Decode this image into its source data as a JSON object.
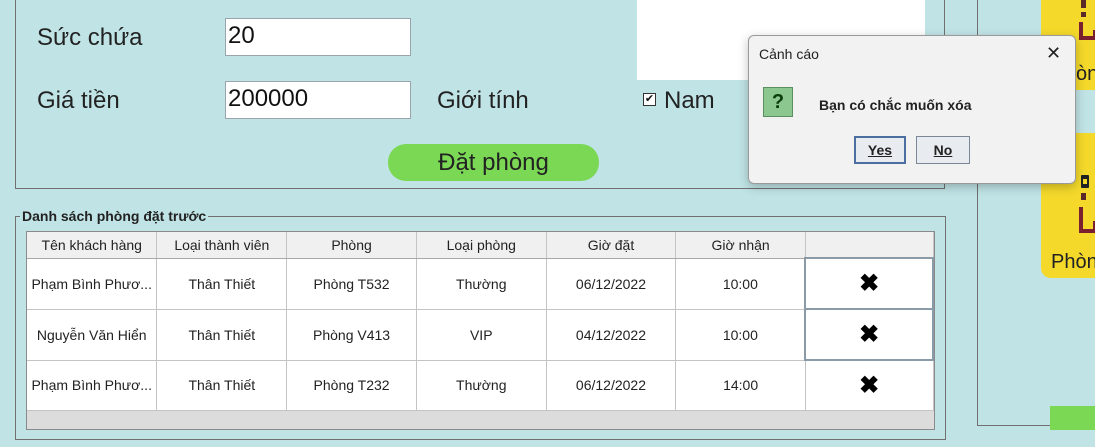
{
  "form": {
    "capacity_label": "Sức chứa",
    "capacity_value": "20",
    "price_label": "Giá tiền",
    "price_value": "200000",
    "gender_label": "Giới tính",
    "gender_checkbox_label": "Nam",
    "gender_checked": true,
    "check_mark": "✔",
    "book_button_label": "Đặt phòng"
  },
  "reservations": {
    "legend": "Danh sách phòng đặt trước",
    "columns": [
      "Tên khách hàng",
      "Loại thành viên",
      "Phòng",
      "Loại phòng",
      "Giờ đặt",
      "Giờ nhận",
      ""
    ],
    "rows": [
      [
        "Phạm Bình Phươ...",
        "Thân Thiết",
        "Phòng T532",
        "Thường",
        "06/12/2022",
        "10:00",
        "✖"
      ],
      [
        "Nguyễn Văn Hiển",
        "Thân Thiết",
        "Phòng V413",
        "VIP",
        "04/12/2022",
        "10:00",
        "✖"
      ],
      [
        "Phạm Bình Phươ...",
        "Thân Thiết",
        "Phòng T232",
        "Thường",
        "06/12/2022",
        "14:00",
        "✖"
      ]
    ]
  },
  "side": {
    "partial_text_1": "òn",
    "partial_text_2": "Phòn"
  },
  "dialog": {
    "title": "Cảnh cáo",
    "close_glyph": "✕",
    "icon_glyph": "?",
    "message": "Bạn có chắc muốn xóa",
    "yes_label": "Yes",
    "no_label": "No"
  },
  "colors": {
    "background": "#c0e4e6",
    "accent_green": "#7ad855",
    "card_yellow": "#f4d92b"
  }
}
